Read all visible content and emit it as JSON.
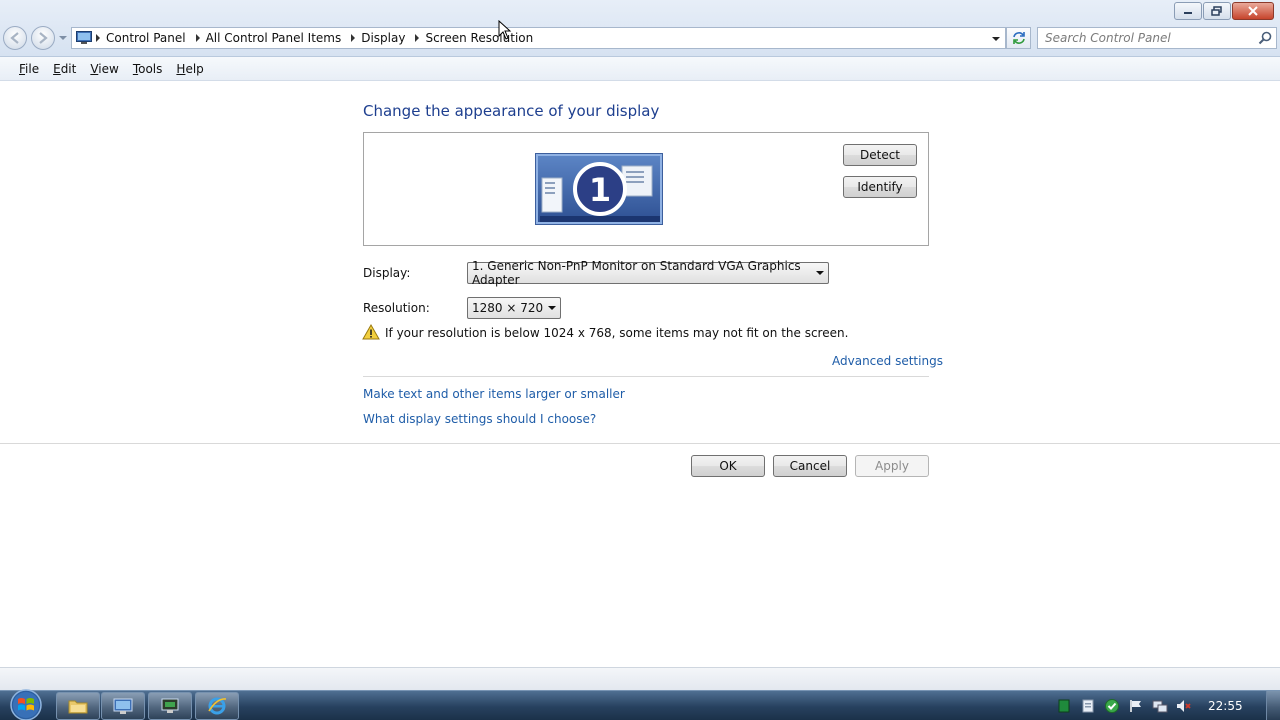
{
  "window": {
    "breadcrumb": [
      "Control Panel",
      "All Control Panel Items",
      "Display",
      "Screen Resolution"
    ],
    "search_placeholder": "Search Control Panel"
  },
  "menu": [
    "File",
    "Edit",
    "View",
    "Tools",
    "Help"
  ],
  "main": {
    "title": "Change the appearance of your display",
    "monitor_number": "1",
    "detect_label": "Detect",
    "identify_label": "Identify",
    "display_label": "Display:",
    "display_value": "1. Generic Non-PnP Monitor on Standard VGA Graphics Adapter",
    "resolution_label": "Resolution:",
    "resolution_value": "1280 × 720",
    "warning": "If your resolution is below 1024 x 768, some items may not fit on the screen.",
    "advanced_link": "Advanced settings",
    "text_size_link": "Make text and other items larger or smaller",
    "help_link": "What display settings should I choose?",
    "ok_label": "OK",
    "cancel_label": "Cancel",
    "apply_label": "Apply"
  },
  "taskbar": {
    "clock": "22:55",
    "pinned": [
      "windows-explorer-icon",
      "control-panel-icon",
      "display-settings-icon",
      "internet-explorer-icon"
    ]
  },
  "colors": {
    "title_blue": "#1e3f8f",
    "link_blue": "#1f5da8",
    "taskbar": "#27415f"
  }
}
